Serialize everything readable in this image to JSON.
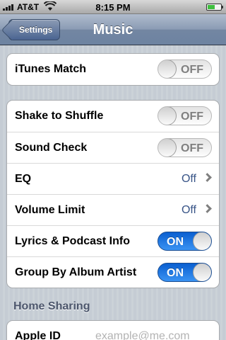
{
  "status_bar": {
    "carrier": "AT&T",
    "time": "8:15 PM",
    "wifi_icon": "wifi-icon",
    "battery_icon": "battery-icon"
  },
  "nav": {
    "back_label": "Settings",
    "title": "Music"
  },
  "group1": {
    "itunes_match": {
      "label": "iTunes Match",
      "state": "OFF"
    }
  },
  "group2": {
    "shake": {
      "label": "Shake to Shuffle",
      "state": "OFF"
    },
    "sound_check": {
      "label": "Sound Check",
      "state": "OFF"
    },
    "eq": {
      "label": "EQ",
      "value": "Off"
    },
    "volume_limit": {
      "label": "Volume Limit",
      "value": "Off"
    },
    "lyrics": {
      "label": "Lyrics & Podcast Info",
      "state": "ON"
    },
    "group_album": {
      "label": "Group By Album Artist",
      "state": "ON"
    }
  },
  "home_sharing": {
    "header": "Home Sharing",
    "apple_id_label": "Apple ID",
    "apple_id_placeholder": "example@me.com"
  },
  "colors": {
    "switch_on": "#1f6fdc",
    "value_text": "#385487",
    "nav_bar": "#6d83a1"
  }
}
